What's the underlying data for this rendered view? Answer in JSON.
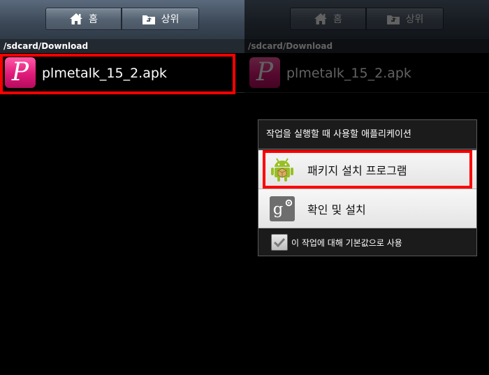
{
  "nav": {
    "home_label": "홈",
    "up_label": "상위",
    "home_icon": "home-icon",
    "up_icon": "folder-up-icon"
  },
  "path": "/sdcard/Download",
  "file": {
    "name": "plmetalk_15_2.apk",
    "icon_letter": "P",
    "icon": "plmetalk-app-icon"
  },
  "dialog": {
    "title": "작업을 실행할 때 사용할 애플리케이션",
    "options": [
      {
        "label": "패키지 설치 프로그램",
        "icon": "android-package-installer-icon"
      },
      {
        "label": "확인 및 설치",
        "icon": "google-plus-icon",
        "icon_text": "g"
      }
    ],
    "default_checkbox": {
      "label": "이 작업에 대해 기본값으로 사용",
      "checked": true
    }
  },
  "colors": {
    "highlight": "#ff0000",
    "app_pink": "#e01a79",
    "android_green": "#97c024"
  }
}
